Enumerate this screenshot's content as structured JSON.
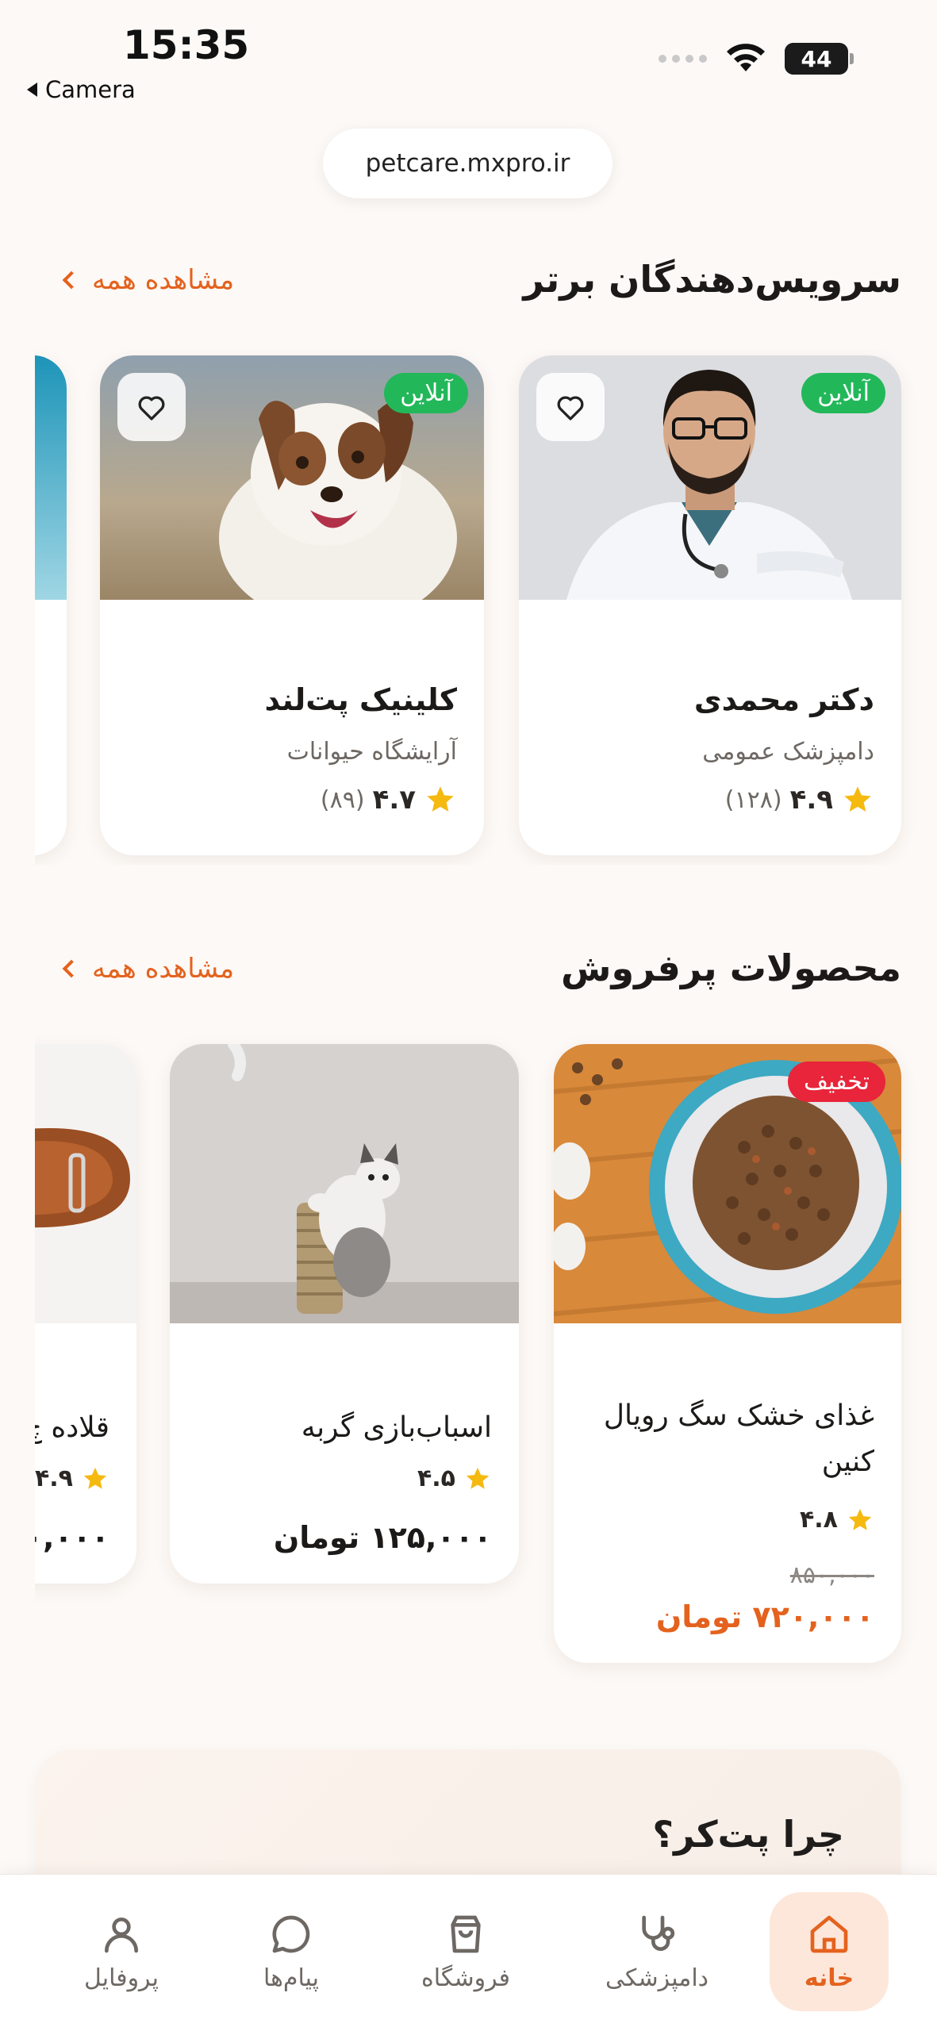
{
  "status": {
    "time": "15:35",
    "back_label": "Camera",
    "battery": "44"
  },
  "browser": {
    "url": "petcare.mxpro.ir"
  },
  "colors": {
    "accent": "#e4621e",
    "online": "#22b85a",
    "discount": "#e8253a",
    "star": "#f5b90f"
  },
  "top_providers": {
    "title": "سرویس‌دهندگان برتر",
    "see_all": "مشاهده همه",
    "items": [
      {
        "name": "دکتر محمدی",
        "subtitle": "دامپزشک عمومی",
        "rating": "۴.۹",
        "reviews": "(۱۲۸)",
        "badge": "آنلاین",
        "icon": "heart-icon"
      },
      {
        "name": "کلینیک پت‌لند",
        "subtitle": "آرایشگاه حیوانات",
        "rating": "۴.۷",
        "reviews": "(۸۹)",
        "badge": "آنلاین",
        "icon": "heart-icon"
      }
    ]
  },
  "best_sellers": {
    "title": "محصولات پرفروش",
    "see_all": "مشاهده همه",
    "items": [
      {
        "name": "غذای خشک سگ رویال کنین",
        "rating": "۴.۸",
        "old_price": "۸۵۰,۰۰۰",
        "price": "۷۲۰,۰۰۰ تومان",
        "badge": "تخفیف"
      },
      {
        "name": "اسباب‌بازی گربه",
        "rating": "۴.۵",
        "price": "۱۲۵,۰۰۰ تومان"
      },
      {
        "name": "قلاده چ",
        "rating": "۴.۹",
        "price": "۰,۰۰۰"
      }
    ]
  },
  "why": {
    "title": "چرا پت‌کر؟"
  },
  "nav": [
    {
      "label": "خانه",
      "icon": "home-icon",
      "active": true
    },
    {
      "label": "دامپزشکی",
      "icon": "stethoscope-icon",
      "active": false
    },
    {
      "label": "فروشگاه",
      "icon": "shopping-bag-icon",
      "active": false
    },
    {
      "label": "پیام‌ها",
      "icon": "message-icon",
      "active": false
    },
    {
      "label": "پروفایل",
      "icon": "user-icon",
      "active": false
    }
  ]
}
